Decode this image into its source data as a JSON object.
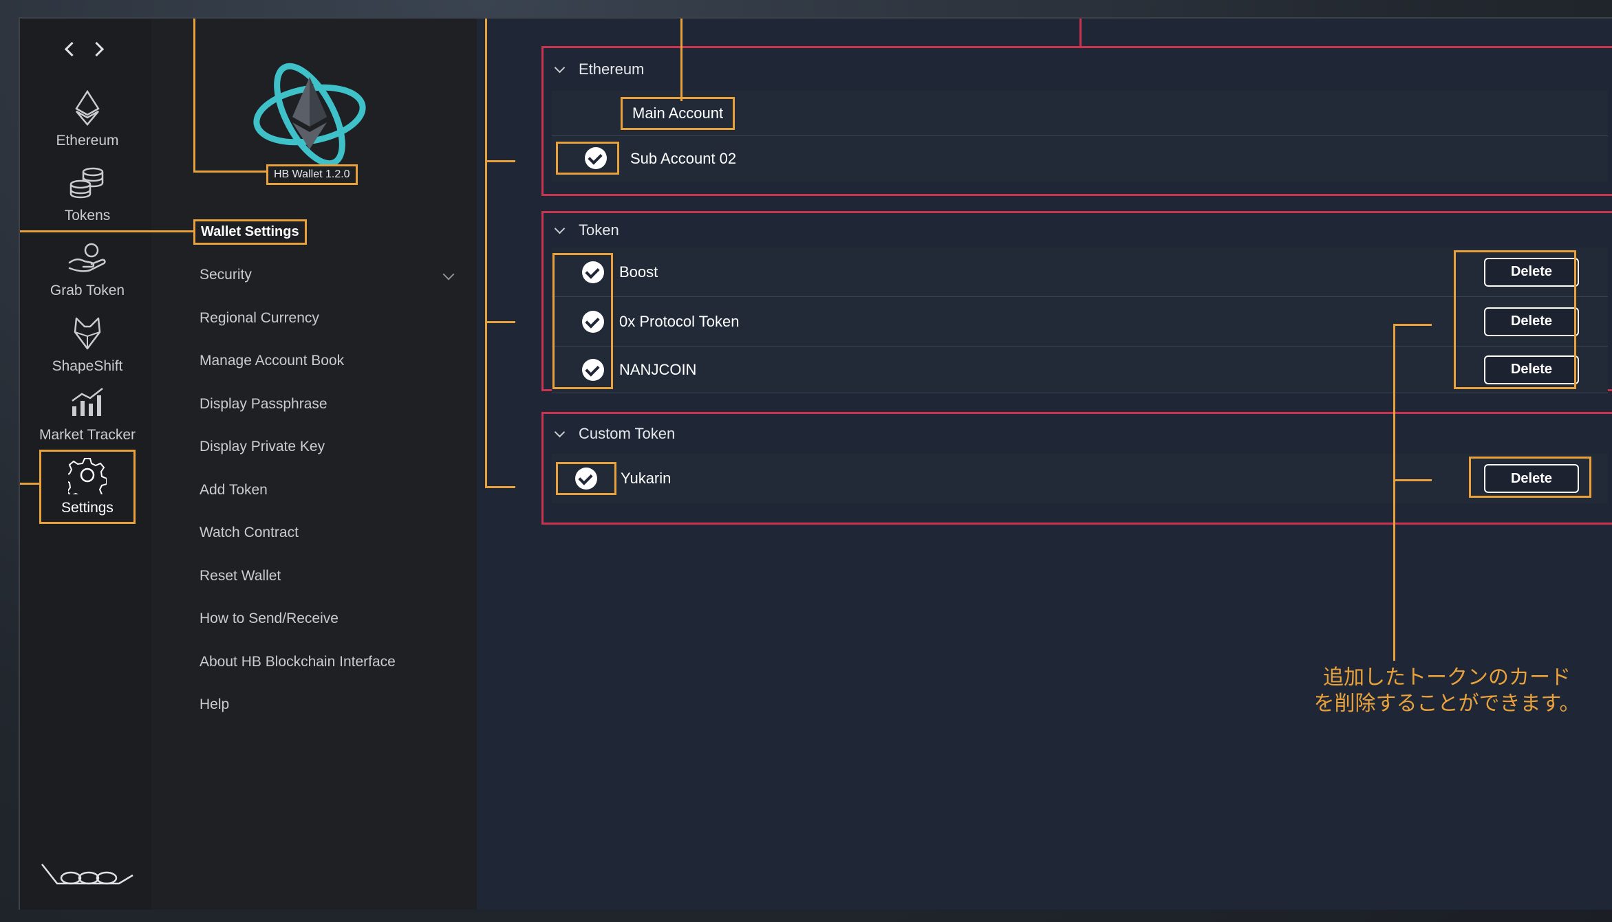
{
  "rail": {
    "items": [
      {
        "label": "Ethereum",
        "icon": "ethereum-icon"
      },
      {
        "label": "Tokens",
        "icon": "coins-stack-icon"
      },
      {
        "label": "Grab Token",
        "icon": "hand-coin-icon"
      },
      {
        "label": "ShapeShift",
        "icon": "fox-icon"
      },
      {
        "label": "Market Tracker",
        "icon": "bar-chart-icon"
      },
      {
        "label": "Settings",
        "icon": "gear-icon",
        "active": true
      }
    ]
  },
  "app": {
    "version": "HB Wallet 1.2.0"
  },
  "menu": {
    "title": "Wallet Settings",
    "items": [
      "Security",
      "Regional Currency",
      "Manage Account Book",
      "Display Passphrase",
      "Display Private Key",
      "Add Token",
      "Watch Contract",
      "Reset Wallet",
      "How to Send/Receive",
      "About HB Blockchain Interface",
      "Help"
    ]
  },
  "sections": {
    "ethereum": {
      "title": "Ethereum",
      "main_account": "Main Account",
      "sub_account": "Sub Account 02"
    },
    "token": {
      "title": "Token",
      "rows": [
        "Boost",
        "0x Protocol Token",
        "NANJCOIN"
      ],
      "delete_label": "Delete"
    },
    "custom_token": {
      "title": "Custom Token",
      "rows": [
        "Yukarin"
      ],
      "delete_label": "Delete"
    }
  },
  "annotation": {
    "line1": "追加したトークンのカード",
    "line2": "を削除することができます。"
  },
  "colors": {
    "accent_orange": "#e9a23b",
    "section_border_red": "#cc3350",
    "content_bg": "#1f2635",
    "rail_bg": "#1b1d20"
  }
}
